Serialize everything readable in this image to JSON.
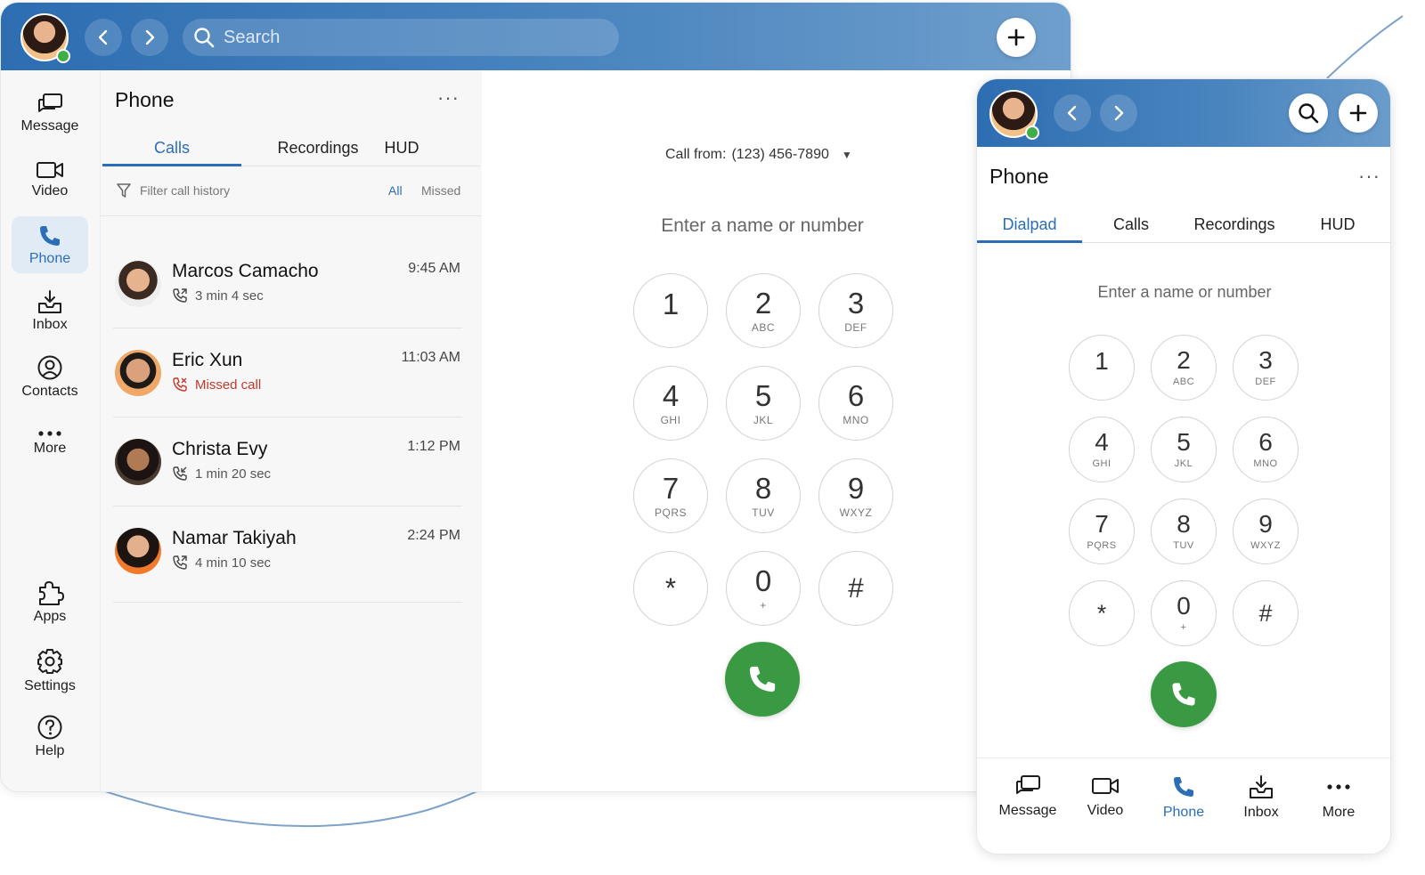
{
  "colors": {
    "brand_blue": "#2c6eb5",
    "call_green": "#3a9a43",
    "missed_red": "#c0392b",
    "presence_green": "#3fae49"
  },
  "desktop": {
    "search": {
      "placeholder": "Search"
    },
    "sidebar": {
      "items": [
        {
          "label": "Message",
          "icon": "message-icon"
        },
        {
          "label": "Video",
          "icon": "video-icon"
        },
        {
          "label": "Phone",
          "icon": "phone-icon",
          "active": true
        },
        {
          "label": "Inbox",
          "icon": "inbox-icon"
        },
        {
          "label": "Contacts",
          "icon": "contacts-icon"
        },
        {
          "label": "More",
          "icon": "more-icon"
        },
        {
          "label": "Apps",
          "icon": "puzzle-icon"
        },
        {
          "label": "Settings",
          "icon": "gear-icon"
        },
        {
          "label": "Help",
          "icon": "help-icon"
        }
      ]
    },
    "phone_pane": {
      "title": "Phone",
      "more": "···",
      "tabs": [
        "Calls",
        "Recordings",
        "HUD"
      ],
      "filter": {
        "placeholder": "Filter call history",
        "all": "All",
        "missed": "Missed"
      },
      "calls": [
        {
          "name": "Marcos Camacho",
          "detail": "3 min 4 sec",
          "time": "9:45 AM",
          "type": "outgoing"
        },
        {
          "name": "Eric Xun",
          "detail": "Missed call",
          "time": "11:03 AM",
          "type": "missed"
        },
        {
          "name": "Christa Evy",
          "detail": "1 min 20 sec",
          "time": "1:12 PM",
          "type": "incoming"
        },
        {
          "name": "Namar Takiyah",
          "detail": "4 min 10 sec",
          "time": "2:24 PM",
          "type": "outgoing"
        }
      ]
    },
    "dialer": {
      "call_from_label": "Call from:",
      "call_from_number": "(123) 456-7890",
      "input_placeholder": "Enter a name or number"
    }
  },
  "keypad": [
    {
      "digit": "1",
      "letters": ""
    },
    {
      "digit": "2",
      "letters": "ABC"
    },
    {
      "digit": "3",
      "letters": "DEF"
    },
    {
      "digit": "4",
      "letters": "GHI"
    },
    {
      "digit": "5",
      "letters": "JKL"
    },
    {
      "digit": "6",
      "letters": "MNO"
    },
    {
      "digit": "7",
      "letters": "PQRS"
    },
    {
      "digit": "8",
      "letters": "TUV"
    },
    {
      "digit": "9",
      "letters": "WXYZ"
    },
    {
      "digit": "*",
      "letters": ""
    },
    {
      "digit": "0",
      "letters": "+"
    },
    {
      "digit": "#",
      "letters": ""
    }
  ],
  "mobile": {
    "title": "Phone",
    "more": "···",
    "tabs": [
      "Dialpad",
      "Calls",
      "Recordings",
      "HUD"
    ],
    "input_placeholder": "Enter a name or number",
    "bottom_nav": [
      {
        "label": "Message",
        "icon": "message-icon"
      },
      {
        "label": "Video",
        "icon": "video-icon"
      },
      {
        "label": "Phone",
        "icon": "phone-icon",
        "active": true
      },
      {
        "label": "Inbox",
        "icon": "inbox-icon"
      },
      {
        "label": "More",
        "icon": "more-icon"
      }
    ]
  }
}
